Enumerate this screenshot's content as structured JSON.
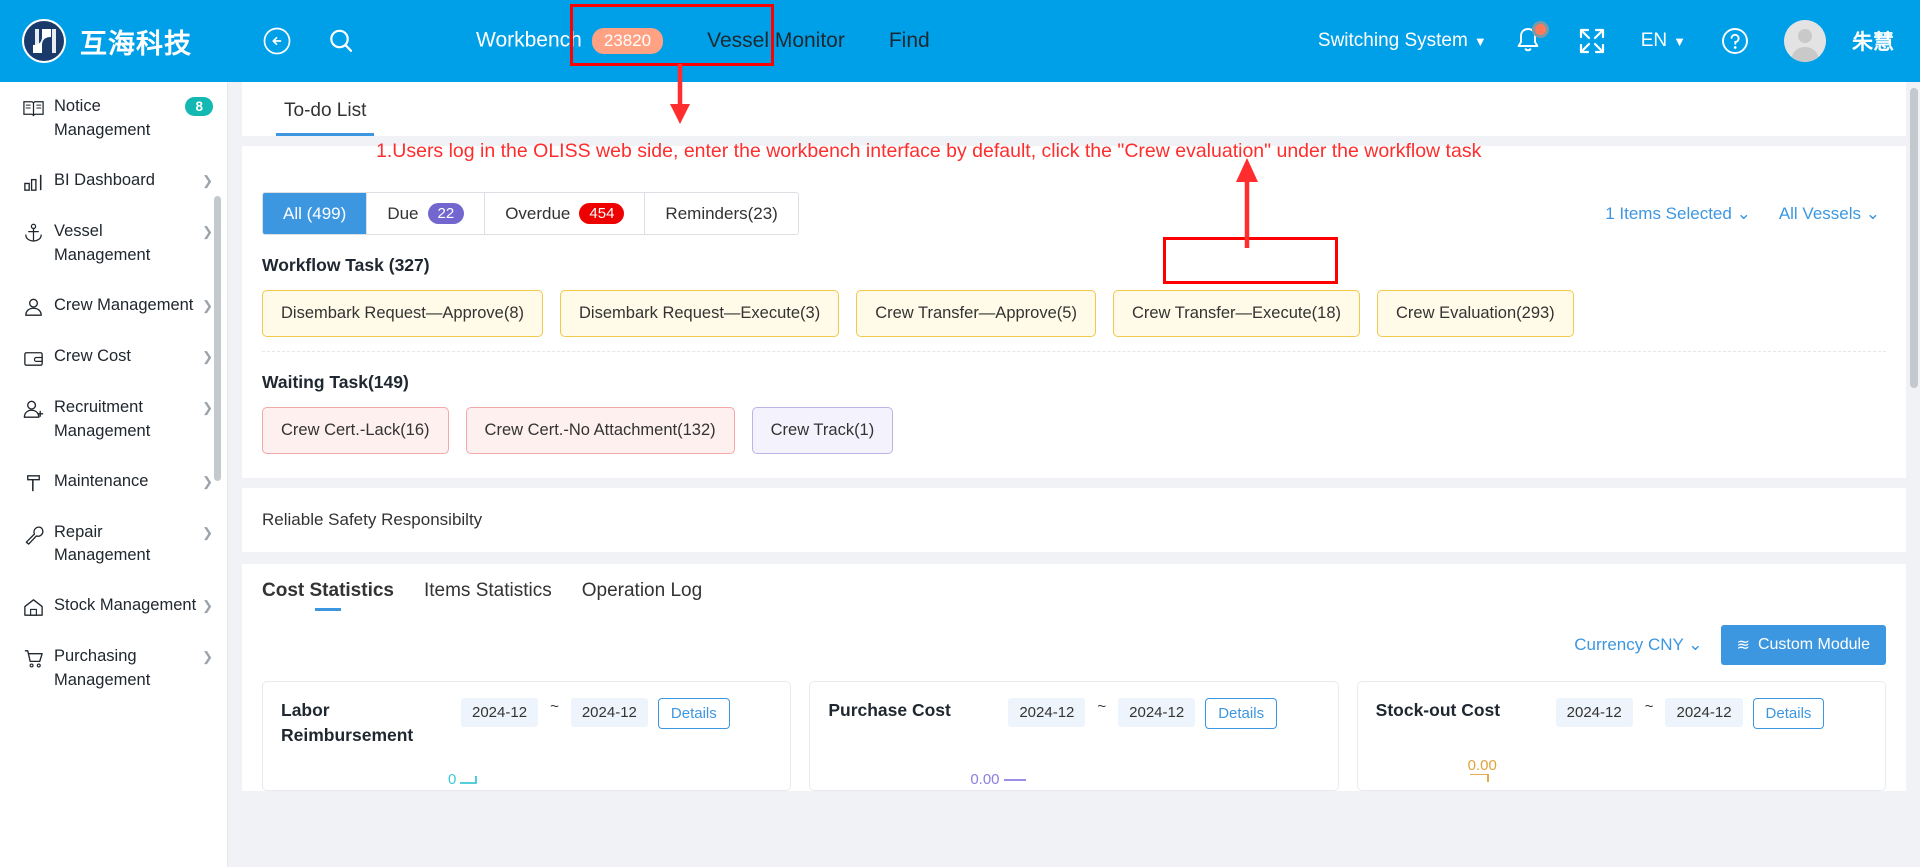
{
  "brand": {
    "name": "互海科技",
    "logo_icon": "company-logo-icon"
  },
  "topbar": {
    "back_icon": "back-arrow-circle-icon",
    "search_icon": "search-icon",
    "menu": [
      {
        "label": "Workbench",
        "badge": "23820",
        "active": true
      },
      {
        "label": "Vessel Monitor",
        "badge": "",
        "active": false
      },
      {
        "label": "Find",
        "badge": "",
        "active": false
      }
    ],
    "switching_system": "Switching System",
    "bell_icon": "notification-bell-icon",
    "fullscreen_icon": "fullscreen-expand-icon",
    "language": "EN",
    "help_icon": "help-question-icon",
    "avatar_icon": "user-avatar-icon",
    "user_name": "朱慧"
  },
  "sidebar": {
    "items": [
      {
        "label": "Notice Management",
        "icon": "notice-book-icon",
        "badge": "8",
        "arrow": false
      },
      {
        "label": "BI Dashboard",
        "icon": "bar-chart-icon",
        "badge": "",
        "arrow": true
      },
      {
        "label": "Vessel Management",
        "icon": "anchor-icon",
        "badge": "",
        "arrow": true
      },
      {
        "label": "Crew Management",
        "icon": "person-icon",
        "badge": "",
        "arrow": true
      },
      {
        "label": "Crew Cost",
        "icon": "wallet-icon",
        "badge": "",
        "arrow": true
      },
      {
        "label": "Recruitment Management",
        "icon": "person-add-icon",
        "badge": "",
        "arrow": true
      },
      {
        "label": "Maintenance",
        "icon": "hammer-icon",
        "badge": "",
        "arrow": true
      },
      {
        "label": "Repair Management",
        "icon": "wrench-icon",
        "badge": "",
        "arrow": true
      },
      {
        "label": "Stock Management",
        "icon": "house-icon",
        "badge": "",
        "arrow": true
      },
      {
        "label": "Purchasing Management",
        "icon": "shopping-cart-icon",
        "badge": "",
        "arrow": true
      }
    ]
  },
  "todo": {
    "tab_label": "To-do List",
    "annotation": "1.Users log in the OLISS web side, enter the workbench interface by default, click the \"Crew evaluation\" under the workflow task",
    "filters": [
      {
        "label": "All (499)",
        "badge": "",
        "badge_color": "",
        "active": true
      },
      {
        "label": "Due",
        "badge": "22",
        "badge_color": "purple",
        "active": false
      },
      {
        "label": "Overdue",
        "badge": "454",
        "badge_color": "red",
        "active": false
      },
      {
        "label": "Reminders(23)",
        "badge": "",
        "badge_color": "",
        "active": false
      }
    ],
    "items_selected": "1 Items Selected",
    "vessel_filter": "All Vessels",
    "workflow_title": "Workflow Task (327)",
    "workflow_chips": [
      {
        "label": "Disembark Request—Approve(8)",
        "style": "yellow",
        "highlighted": false
      },
      {
        "label": "Disembark Request—Execute(3)",
        "style": "yellow",
        "highlighted": false
      },
      {
        "label": "Crew Transfer—Approve(5)",
        "style": "yellow",
        "highlighted": false
      },
      {
        "label": "Crew Transfer—Execute(18)",
        "style": "yellow",
        "highlighted": false
      },
      {
        "label": "Crew Evaluation(293)",
        "style": "yellow",
        "highlighted": true
      }
    ],
    "waiting_title": "Waiting Task(149)",
    "waiting_chips": [
      {
        "label": "Crew Cert.-Lack(16)",
        "style": "pinkish"
      },
      {
        "label": "Crew Cert.-No Attachment(132)",
        "style": "pinkish"
      },
      {
        "label": "Crew Track(1)",
        "style": "violet"
      }
    ]
  },
  "safety": {
    "text": "Reliable Safety Responsibilty"
  },
  "statistics": {
    "tabs": [
      {
        "label": "Cost Statistics",
        "active": true
      },
      {
        "label": "Items Statistics",
        "active": false
      },
      {
        "label": "Operation Log",
        "active": false
      }
    ],
    "currency": "Currency CNY",
    "custom_module": "Custom Module",
    "custom_module_icon": "sliders-icon",
    "cards": [
      {
        "title": "Labor Reimbursement",
        "date_from": "2024-12",
        "date_to": "2024-12",
        "details_label": "Details",
        "value": "0",
        "value_color": "#3ec8d8"
      },
      {
        "title": "Purchase Cost",
        "date_from": "2024-12",
        "date_to": "2024-12",
        "details_label": "Details",
        "value": "0.00",
        "value_color": "#8b7fe0"
      },
      {
        "title": "Stock-out Cost",
        "date_from": "2024-12",
        "date_to": "2024-12",
        "details_label": "Details",
        "value": "0.00",
        "value_color": "#e0a23c"
      }
    ]
  }
}
